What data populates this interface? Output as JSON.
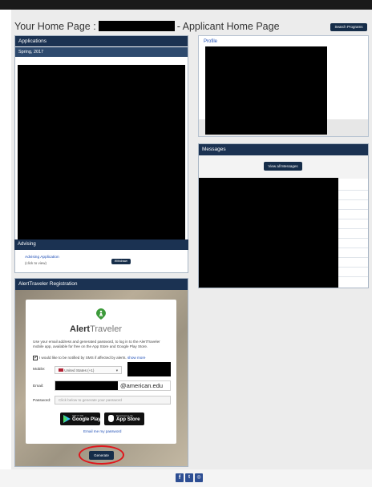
{
  "page": {
    "title_prefix": "Your Home Page :",
    "title_suffix": "- Applicant Home Page",
    "search_button": "Search Programs"
  },
  "applications": {
    "header": "Applications",
    "term": "Spring, 2017",
    "advising_header": "Advising",
    "advising_link": "Advising Application",
    "advising_sub": "(click to view)",
    "status": "Withdrawn"
  },
  "profile": {
    "header": "Profile"
  },
  "messages": {
    "header": "Messages",
    "view_button": "View all Messages"
  },
  "alerttraveler": {
    "header": "AlertTraveler Registration",
    "brand_bold": "Alert",
    "brand_light": "Traveler",
    "description": "Use your email address and generated password, to log in to the AlertTraveler mobile app, available for free on the App Store and Google Play Store.",
    "sms_text": "I would like to be notified by SMS if affected by alerts.",
    "show_more": "show more",
    "mobile_label": "Mobile:",
    "country_value": "United States (+1)",
    "email_label": "Email:",
    "email_domain": "@american.edu",
    "password_label": "Password:",
    "password_placeholder": "Click below to generate your password",
    "google_small": "GET IT ON",
    "google_big": "Google Play",
    "apple_small": "Download on the",
    "apple_big": "App Store",
    "email_password_link": "Email me my password",
    "generate_button": "Generate"
  },
  "colors": {
    "navy": "#1b3252",
    "annotation_red": "#e0161b",
    "brand_green": "#3c9a3a"
  },
  "footer": {
    "icons": [
      "facebook-icon",
      "twitter-icon",
      "instagram-icon"
    ]
  }
}
